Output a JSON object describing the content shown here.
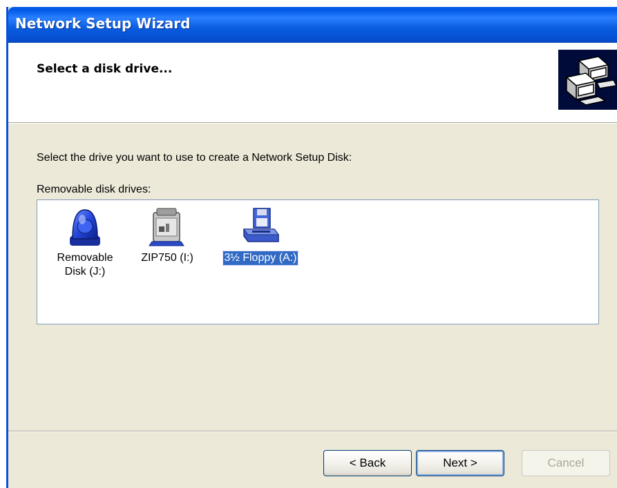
{
  "window": {
    "title": "Network Setup Wizard"
  },
  "header": {
    "title": "Select a disk drive...",
    "icon": "network-computers-icon"
  },
  "content": {
    "prompt": "Select the drive you want to use to create a Network Setup Disk:",
    "list_label": "Removable disk drives:",
    "drives": [
      {
        "label_line1": "Removable",
        "label_line2": "Disk (J:)",
        "icon": "removable-disk-icon",
        "selected": false
      },
      {
        "label_line1": "ZIP750 (I:)",
        "icon": "zip-drive-icon",
        "selected": false
      },
      {
        "label_line1": "3½ Floppy (A:)",
        "icon": "floppy-drive-icon",
        "selected": true
      }
    ]
  },
  "buttons": {
    "back": "< Back",
    "next": "Next >",
    "cancel": "Cancel"
  },
  "colors": {
    "title_bar": "#0a5cdf",
    "selection": "#316ac5",
    "window_bg": "#ece9d8"
  }
}
